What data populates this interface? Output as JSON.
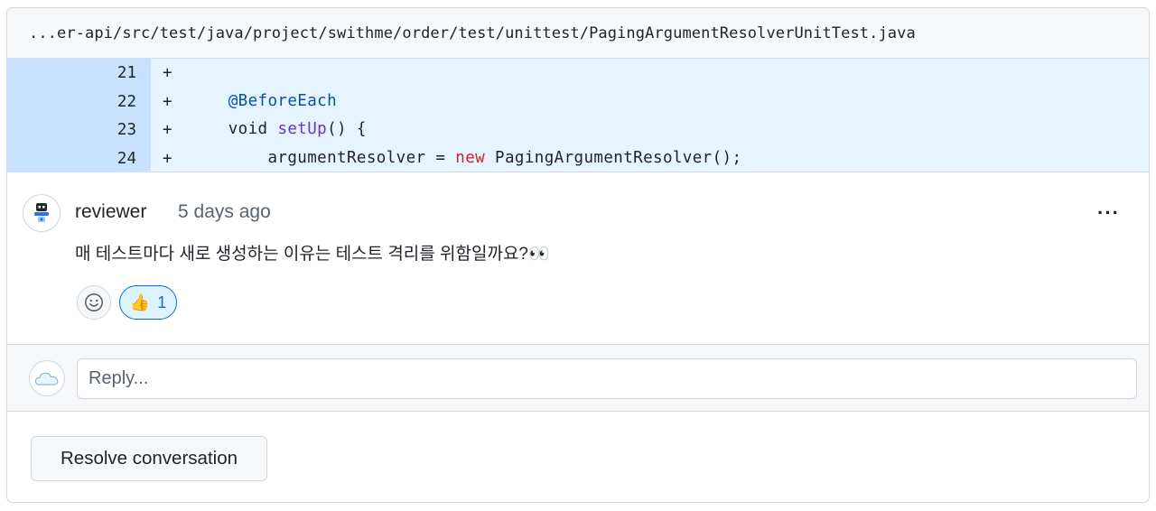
{
  "file": {
    "path": "...er-api/src/test/java/project/swithme/order/test/unittest/PagingArgumentResolverUnitTest.java"
  },
  "diff": {
    "lines": [
      {
        "number": "21",
        "marker": "+",
        "code": []
      },
      {
        "number": "22",
        "marker": "+",
        "code": [
          {
            "text": "    ",
            "kind": "plain"
          },
          {
            "text": "@BeforeEach",
            "kind": "annot"
          }
        ]
      },
      {
        "number": "23",
        "marker": "+",
        "code": [
          {
            "text": "    void ",
            "kind": "plain"
          },
          {
            "text": "setUp",
            "kind": "fn"
          },
          {
            "text": "() {",
            "kind": "plain"
          }
        ]
      },
      {
        "number": "24",
        "marker": "+",
        "code": [
          {
            "text": "        argumentResolver = ",
            "kind": "plain"
          },
          {
            "text": "new",
            "kind": "kw"
          },
          {
            "text": " PagingArgumentResolver();",
            "kind": "plain"
          }
        ]
      }
    ]
  },
  "comment": {
    "author": "reviewer",
    "time": "5 days ago",
    "more_label": "···",
    "body": "매 테스트마다 새로 생성하는 이유는 테스트 격리를 위함일까요?👀",
    "reactions": {
      "add_icon": "smiley-icon",
      "items": [
        {
          "emoji": "👍",
          "count": "1",
          "icon": "thumbs-up-icon"
        }
      ]
    }
  },
  "reply": {
    "placeholder": "Reply..."
  },
  "actions": {
    "resolve_label": "Resolve conversation"
  },
  "colors": {
    "added_bg": "#e6f4ff",
    "added_gutter": "#c8e1ff",
    "accent": "#0969da"
  }
}
